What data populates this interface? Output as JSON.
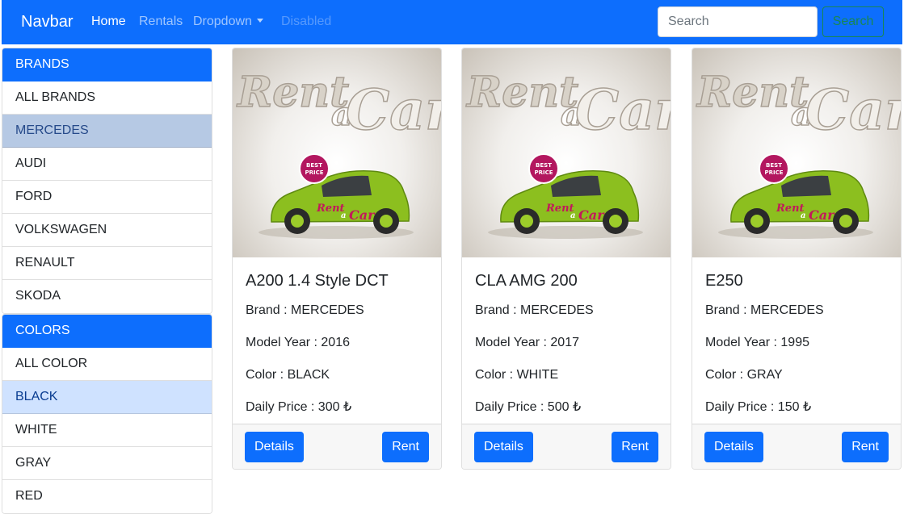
{
  "navbar": {
    "brand": "Navbar",
    "links": [
      "Home",
      "Rentals",
      "Dropdown",
      "Disabled"
    ],
    "search_placeholder": "Search",
    "search_button": "Search",
    "accent": "#0d6efd"
  },
  "sidebar": {
    "brands_header": "BRANDS",
    "brands": [
      "ALL BRANDS",
      "MERCEDES",
      "AUDI",
      "FORD",
      "VOLKSWAGEN",
      "RENAULT",
      "SKODA"
    ],
    "colors_header": "COLORS",
    "colors": [
      "ALL COLOR",
      "BLACK",
      "WHITE",
      "GRAY",
      "RED"
    ]
  },
  "image_text": {
    "rent": "Rent",
    "a": "a",
    "car": "Car",
    "badge_line1": "BEST",
    "badge_line2": "PRICE"
  },
  "cars": [
    {
      "title": "A200 1.4 Style DCT",
      "brand": "Brand : MERCEDES",
      "model_year": "Model Year : 2016",
      "color": "Color : BLACK",
      "daily_price": "Daily Price : 300 ₺",
      "details_label": "Details",
      "rent_label": "Rent"
    },
    {
      "title": "CLA AMG 200",
      "brand": "Brand : MERCEDES",
      "model_year": "Model Year : 2017",
      "color": "Color : WHITE",
      "daily_price": "Daily Price : 500 ₺",
      "details_label": "Details",
      "rent_label": "Rent"
    },
    {
      "title": "E250",
      "brand": "Brand : MERCEDES",
      "model_year": "Model Year : 1995",
      "color": "Color : GRAY",
      "daily_price": "Daily Price : 150 ₺",
      "details_label": "Details",
      "rent_label": "Rent"
    }
  ]
}
